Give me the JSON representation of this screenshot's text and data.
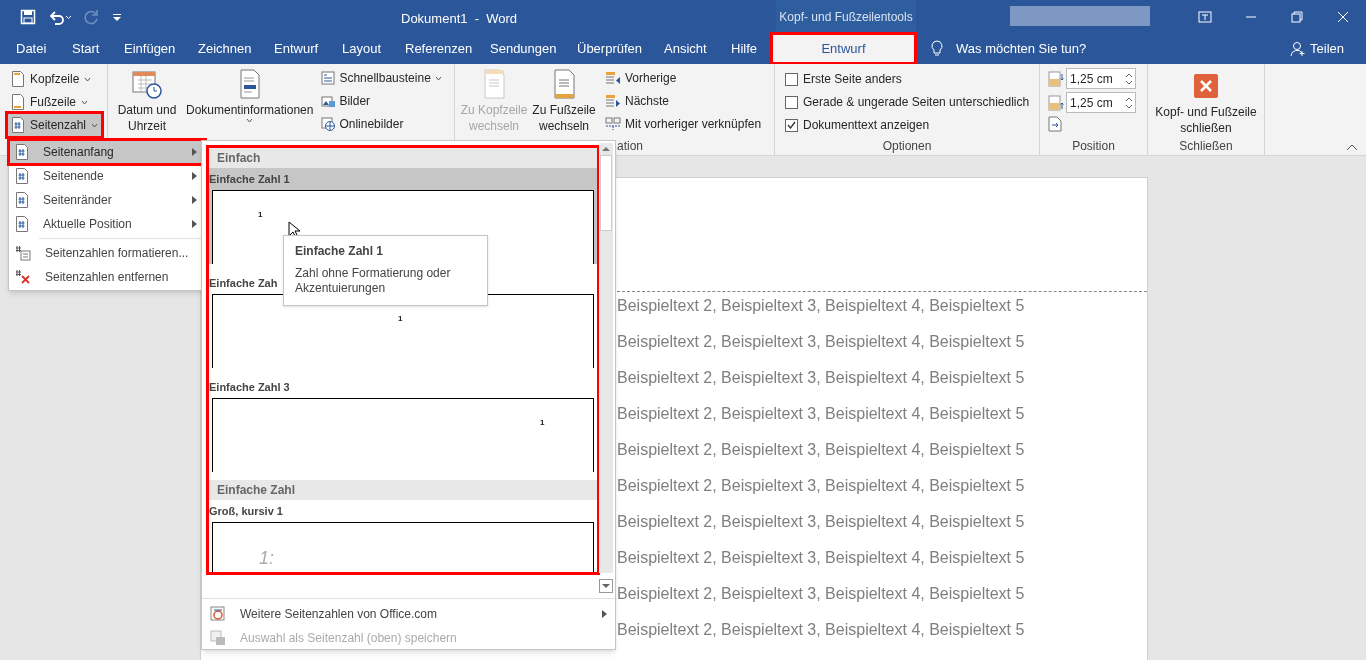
{
  "quick_access": [
    {
      "kind": "save",
      "disabled": false
    },
    {
      "kind": "undo",
      "disabled": false
    },
    {
      "kind": "redo",
      "disabled": true
    },
    {
      "kind": "customize",
      "disabled": false
    }
  ],
  "window": {
    "title": "Dokument1  -  Word",
    "context_label": "Kopf- und Fußzeilentools"
  },
  "tabs": [
    {
      "label": "Datei",
      "selected": false,
      "contextual": false
    },
    {
      "label": "Start",
      "selected": false,
      "contextual": false
    },
    {
      "label": "Einfügen",
      "selected": false,
      "contextual": false
    },
    {
      "label": "Zeichnen",
      "selected": false,
      "contextual": false
    },
    {
      "label": "Entwurf",
      "selected": false,
      "contextual": false
    },
    {
      "label": "Layout",
      "selected": false,
      "contextual": false
    },
    {
      "label": "Referenzen",
      "selected": false,
      "contextual": false
    },
    {
      "label": "Sendungen",
      "selected": false,
      "contextual": false
    },
    {
      "label": "Überprüfen",
      "selected": false,
      "contextual": false
    },
    {
      "label": "Ansicht",
      "selected": false,
      "contextual": false
    },
    {
      "label": "Hilfe",
      "selected": false,
      "contextual": false
    },
    {
      "label": "Entwurf",
      "selected": true,
      "contextual": true,
      "highlighted": true
    }
  ],
  "tell_me": "Was möchten Sie tun?",
  "share": "Teilen",
  "header_footer_group": {
    "buttons": [
      {
        "label": "Kopfzeile",
        "pressed": false,
        "highlighted": false
      },
      {
        "label": "Fußzeile",
        "pressed": false,
        "highlighted": false
      },
      {
        "label": "Seitenzahl",
        "pressed": true,
        "highlighted": true
      }
    ]
  },
  "insert_group": {
    "large_buttons": [
      {
        "label": "Datum und Uhrzeit",
        "kind": "date",
        "has_dropdown": false
      },
      {
        "label": "Dokumentinformationen",
        "kind": "docinfo",
        "has_dropdown": true
      }
    ],
    "small_buttons": [
      {
        "label": "Schnellbausteine",
        "kind": "parts",
        "has_dropdown": true
      },
      {
        "label": "Bilder",
        "kind": "pictures",
        "has_dropdown": false
      },
      {
        "label": "Onlinebilder",
        "kind": "online",
        "has_dropdown": false
      }
    ]
  },
  "navigation_group": {
    "label": "ation",
    "large_buttons": [
      {
        "label": "Zu Kopfzeile wechseln",
        "disabled": true
      },
      {
        "label": "Zu Fußzeile wechseln",
        "disabled": false
      }
    ],
    "small_buttons": [
      {
        "label": "Vorherige",
        "kind": "previous"
      },
      {
        "label": "Nächste",
        "kind": "next"
      },
      {
        "label": "Mit vorheriger verknüpfen",
        "kind": "link"
      }
    ]
  },
  "options_group": {
    "label": "Optionen",
    "checkboxes": [
      {
        "label": "Erste Seite anders",
        "checked": false
      },
      {
        "label": "Gerade & ungerade Seiten unterschiedlich",
        "checked": false
      },
      {
        "label": "Dokumenttext anzeigen",
        "checked": true
      }
    ]
  },
  "position_group": {
    "label": "Position",
    "fields": [
      {
        "kind": "top",
        "value": "1,25 cm"
      },
      {
        "kind": "bottom",
        "value": "1,25 cm"
      }
    ]
  },
  "close_group": {
    "label": "Schließen",
    "button": "Kopf- und Fußzeile schließen"
  },
  "page_number_menu": {
    "items": [
      {
        "label": "Seitenanfang",
        "kind": "submenu",
        "selected": true,
        "highlighted": true
      },
      {
        "label": "Seitenende",
        "kind": "submenu",
        "selected": false,
        "highlighted": false
      },
      {
        "label": "Seitenränder",
        "kind": "submenu",
        "selected": false,
        "highlighted": false
      },
      {
        "label": "Aktuelle Position",
        "kind": "submenu",
        "selected": false,
        "highlighted": false
      },
      {
        "label": "Seitenzahlen formatieren...",
        "kind": "format",
        "selected": false,
        "highlighted": false
      },
      {
        "label": "Seitenzahlen entfernen",
        "kind": "remove",
        "selected": false,
        "highlighted": false
      }
    ]
  },
  "gallery": {
    "highlighted": true,
    "sections": [
      {
        "title": "Einfach",
        "items": [
          {
            "label": "Einfache Zahl 1",
            "selected": true,
            "number": "1",
            "kind": "left"
          },
          {
            "label": "Einfache Zah",
            "selected": false,
            "number": "1",
            "kind": "center"
          },
          {
            "label": "Einfache Zahl 3",
            "selected": false,
            "number": "1",
            "kind": "right"
          }
        ]
      },
      {
        "title": "Einfache Zahl",
        "items": [
          {
            "label": "Groß, kursiv 1",
            "selected": false,
            "number": "1:",
            "kind": "italic"
          }
        ]
      }
    ],
    "footer": [
      {
        "label": "Weitere Seitenzahlen von Office.com",
        "disabled": false,
        "submenu": true
      },
      {
        "label": "Auswahl als Seitenzahl (oben) speichern",
        "disabled": true,
        "submenu": false
      }
    ]
  },
  "tooltip": {
    "title": "Einfache Zahl 1",
    "text": "Zahl ohne Formatierung oder Akzentuierungen"
  },
  "document": {
    "lines": [
      "Beispieltext 2, Beispieltext 3, Beispieltext 4, Beispieltext 5",
      "Beispieltext 2, Beispieltext 3, Beispieltext 4, Beispieltext 5",
      "Beispieltext 2, Beispieltext 3, Beispieltext 4, Beispieltext 5",
      "Beispieltext 2, Beispieltext 3, Beispieltext 4, Beispieltext 5",
      "Beispieltext 2, Beispieltext 3, Beispieltext 4, Beispieltext 5",
      "Beispieltext 2, Beispieltext 3, Beispieltext 4, Beispieltext 5",
      "Beispieltext 2, Beispieltext 3, Beispieltext 4, Beispieltext 5",
      "Beispieltext 2, Beispieltext 3, Beispieltext 4, Beispieltext 5",
      "Beispieltext 2, Beispieltext 3, Beispieltext 4, Beispieltext 5",
      "Beispieltext 2, Beispieltext 3, Beispieltext 4, Beispieltext 5"
    ]
  }
}
